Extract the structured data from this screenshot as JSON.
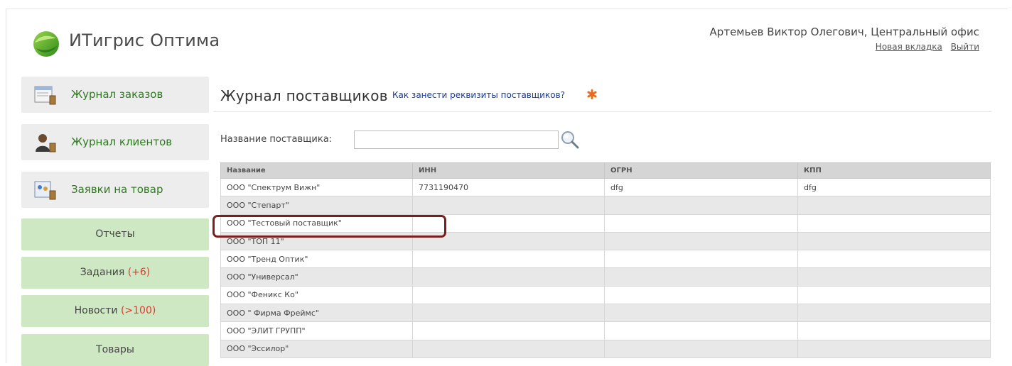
{
  "header": {
    "brand": "ИТигрис Оптима",
    "user": "Артемьев Виктор Олегович, Центральный офис",
    "links": [
      "Новая вкладка",
      "Выйти"
    ]
  },
  "sidebar": {
    "journal_items": [
      {
        "label": "Журнал заказов",
        "icon": "orders-icon"
      },
      {
        "label": "Журнал клиентов",
        "icon": "clients-icon"
      },
      {
        "label": "Заявки на товар",
        "icon": "requests-icon"
      }
    ],
    "buttons": [
      {
        "label": "Отчеты",
        "count": ""
      },
      {
        "label": "Задания ",
        "count": "(+6)"
      },
      {
        "label": "Новости ",
        "count": "(>100)"
      },
      {
        "label": "Товары",
        "count": ""
      }
    ]
  },
  "main": {
    "title": "Журнал поставщиков",
    "help_link": "Как занести реквизиты поставщиков?",
    "filter": {
      "label": "Название поставщика:",
      "value": ""
    },
    "table": {
      "columns": [
        "Название",
        "ИНН",
        "ОГРН",
        "КПП"
      ],
      "rows": [
        [
          "ООО \"Спектрум Вижн\"",
          "7731190470",
          "dfg",
          "dfg"
        ],
        [
          "ООО \"Степарт\"",
          "",
          "",
          ""
        ],
        [
          "ООО \"Тестовый поставщик\"",
          "",
          "",
          ""
        ],
        [
          "ООО \"ТОП 11\"",
          "",
          "",
          ""
        ],
        [
          "ООО \"Тренд Оптик\"",
          "",
          "",
          ""
        ],
        [
          "ООО \"Универсал\"",
          "",
          "",
          ""
        ],
        [
          "ООО \"Феникс Ко\"",
          "",
          "",
          ""
        ],
        [
          "ООО \" Фирма Фреймс\"",
          "",
          "",
          ""
        ],
        [
          "ООО \"ЭЛИТ ГРУПП\"",
          "",
          "",
          ""
        ],
        [
          "ООО \"Эссилор\"",
          "",
          "",
          ""
        ]
      ]
    }
  },
  "colors": {
    "accent_green": "#2c7a1e",
    "button_green": "#cfe8c4",
    "count_red": "#e03a2e",
    "highlight": "#7a1f1f"
  }
}
